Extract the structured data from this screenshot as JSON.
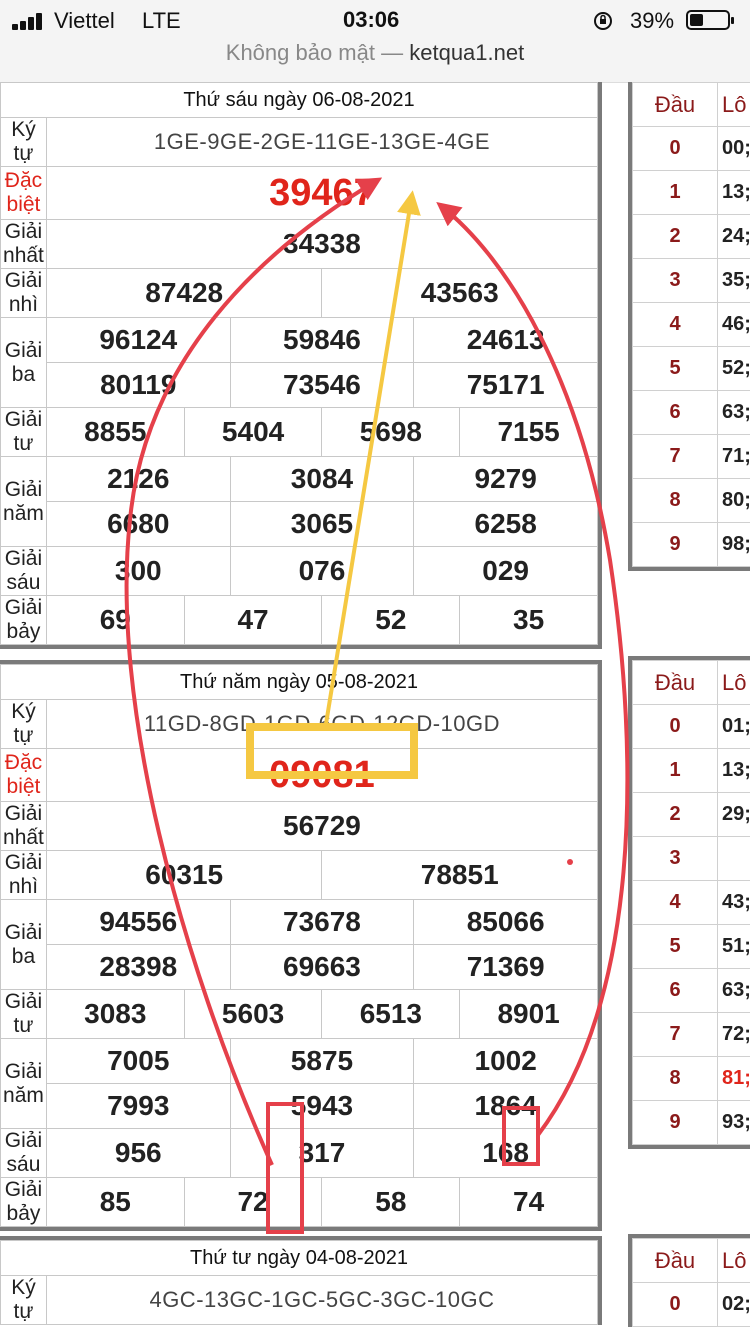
{
  "status": {
    "carrier": "Viettel",
    "network": "LTE",
    "time": "03:06",
    "battery": "39%",
    "battery_level": 0.39
  },
  "browser": {
    "security": "Không bảo mật —",
    "domain": "ketqua1.net"
  },
  "labels": {
    "kytu": "Ký tự",
    "db": "Đặc biệt",
    "g1": "Giải nhất",
    "g2": "Giải nhì",
    "g3": "Giải ba",
    "g4": "Giải tư",
    "g5": "Giải năm",
    "g6": "Giải sáu",
    "g7": "Giải bảy",
    "dau": "Đầu",
    "loto": "Lô"
  },
  "draws": [
    {
      "date": "Thứ sáu ngày 06-08-2021",
      "kytu": "1GE-9GE-2GE-11GE-13GE-4GE",
      "db": "39467",
      "g1": "34338",
      "g2": [
        "87428",
        "43563"
      ],
      "g3": [
        "96124",
        "59846",
        "24613",
        "80119",
        "73546",
        "75171"
      ],
      "g4": [
        "8855",
        "5404",
        "5698",
        "7155"
      ],
      "g5": [
        "2126",
        "3084",
        "9279",
        "6680",
        "3065",
        "6258"
      ],
      "g6": [
        "300",
        "076",
        "029"
      ],
      "g7": [
        "69",
        "47",
        "52",
        "35"
      ],
      "loto": [
        {
          "d": "0",
          "v": "00;"
        },
        {
          "d": "1",
          "v": "13;"
        },
        {
          "d": "2",
          "v": "24;"
        },
        {
          "d": "3",
          "v": "35;"
        },
        {
          "d": "4",
          "v": "46;"
        },
        {
          "d": "5",
          "v": "52;"
        },
        {
          "d": "6",
          "v": "63;"
        },
        {
          "d": "7",
          "v": "71;"
        },
        {
          "d": "8",
          "v": "80;"
        },
        {
          "d": "9",
          "v": "98;"
        }
      ]
    },
    {
      "date": "Thứ năm ngày 05-08-2021",
      "kytu": "11GD-8GD-1GD-6GD-12GD-10GD",
      "db": "09081",
      "g1": "56729",
      "g2": [
        "60315",
        "78851"
      ],
      "g3": [
        "94556",
        "73678",
        "85066",
        "28398",
        "69663",
        "71369"
      ],
      "g4": [
        "3083",
        "5603",
        "6513",
        "8901"
      ],
      "g5": [
        "7005",
        "5875",
        "1002",
        "7993",
        "5943",
        "1864"
      ],
      "g6": [
        "956",
        "317",
        "168"
      ],
      "g7": [
        "85",
        "72",
        "58",
        "74"
      ],
      "loto": [
        {
          "d": "0",
          "v": "01;"
        },
        {
          "d": "1",
          "v": "13;"
        },
        {
          "d": "2",
          "v": "29;"
        },
        {
          "d": "3",
          "v": ""
        },
        {
          "d": "4",
          "v": "43;"
        },
        {
          "d": "5",
          "v": "51;"
        },
        {
          "d": "6",
          "v": "63;"
        },
        {
          "d": "7",
          "v": "72;"
        },
        {
          "d": "8",
          "v": "81;"
        },
        {
          "d": "9",
          "v": "93;"
        }
      ]
    },
    {
      "date": "Thứ tư ngày 04-08-2021",
      "kytu": "4GC-13GC-1GC-5GC-3GC-10GC",
      "loto": [
        {
          "d": "0",
          "v": "02;"
        }
      ]
    }
  ],
  "colors": {
    "red": "#e0251b",
    "yellow": "#f5c842",
    "annotation_red": "#e5404a"
  }
}
